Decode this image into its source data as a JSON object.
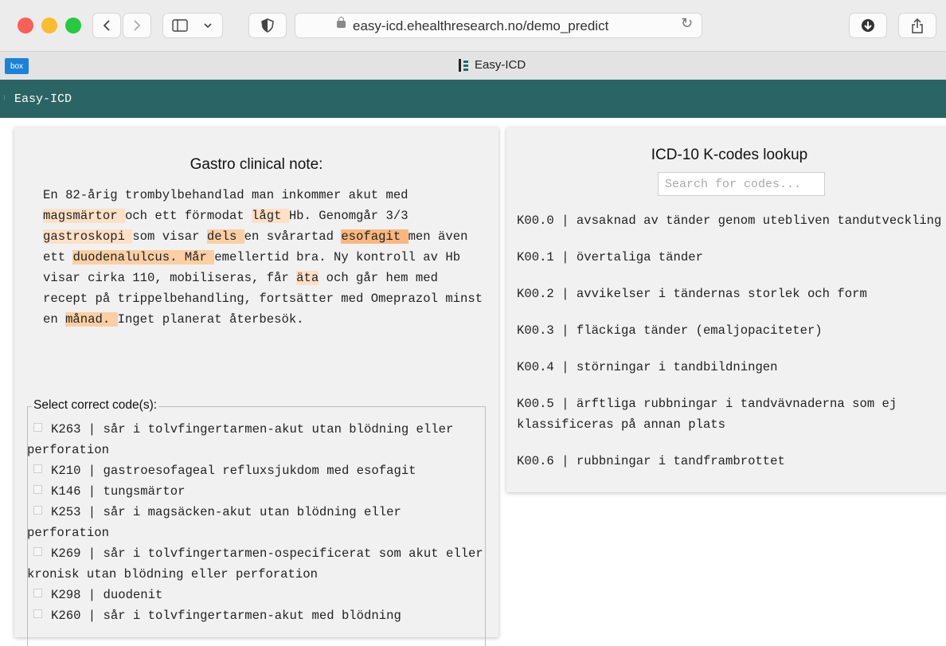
{
  "browser": {
    "url": "easy-icd.ehealthresearch.no/demo_predict",
    "tab_title": "Easy-ICD",
    "favicon_label": "box"
  },
  "app": {
    "title": "Easy-ICD"
  },
  "note": {
    "title": "Gastro clinical note:",
    "segments": [
      {
        "text": "En 82-årig trombylbehandlad man inkommer akut med ",
        "hl": 0
      },
      {
        "text": "magsmärtor ",
        "hl": 1
      },
      {
        "text": "och ett förmodat ",
        "hl": 0
      },
      {
        "text": "lågt ",
        "hl": 1
      },
      {
        "text": "Hb. Genomgår 3/3 ",
        "hl": 0
      },
      {
        "text": "gastroskopi ",
        "hl": 1
      },
      {
        "text": "som visar ",
        "hl": 0
      },
      {
        "text": "dels ",
        "hl": 2
      },
      {
        "text": "en svårartad ",
        "hl": 0
      },
      {
        "text": "esofagit ",
        "hl": 3
      },
      {
        "text": "men även ett ",
        "hl": 0
      },
      {
        "text": "duodenalulcus. Mår ",
        "hl": 2
      },
      {
        "text": "emellertid bra. Ny kontroll av Hb visar cirka 110, mobiliseras, får ",
        "hl": 0
      },
      {
        "text": "äta",
        "hl": 1
      },
      {
        "text": " och går hem med recept på trippelbehandling, fortsätter med Omeprazol minst en ",
        "hl": 0
      },
      {
        "text": "månad. ",
        "hl": 2
      },
      {
        "text": "Inget planerat återbesök.",
        "hl": 0
      }
    ]
  },
  "select_codes": {
    "legend": "Select correct code(s):",
    "items": [
      "K263 | sår i tolvfingertarmen-akut utan blödning eller perforation",
      "K210 | gastroesofageal refluxsjukdom med esofagit",
      "K146 | tungsmärtor",
      "K253 | sår i magsäcken-akut utan blödning eller perforation",
      "K269 | sår i tolvfingertarmen-ospecificerat som akut eller kronisk utan blödning eller perforation",
      "K298 | duodenit",
      "K260 | sår i tolvfingertarmen-akut med blödning"
    ]
  },
  "lookup": {
    "title": "ICD-10 K-codes lookup",
    "search_placeholder": "Search for codes...",
    "codes": [
      "K00.0 | avsaknad av tänder genom utebliven tandutveckling",
      "K00.1 | övertaliga tänder",
      "K00.2 | avvikelser i tändernas storlek och form",
      "K00.3 | fläckiga tänder (emaljopaciteter)",
      "K00.4 | störningar i tandbildningen",
      "K00.5 | ärftliga rubbningar i tandvävnaderna som ej klassificeras på annan plats",
      "K00.6 | rubbningar i tandframbrottet"
    ]
  },
  "colors": {
    "app_header": "#2b6464",
    "highlight_light": "#fde0c5",
    "highlight_medium": "#fbcfa3",
    "highlight_strong": "#f9b77d"
  }
}
